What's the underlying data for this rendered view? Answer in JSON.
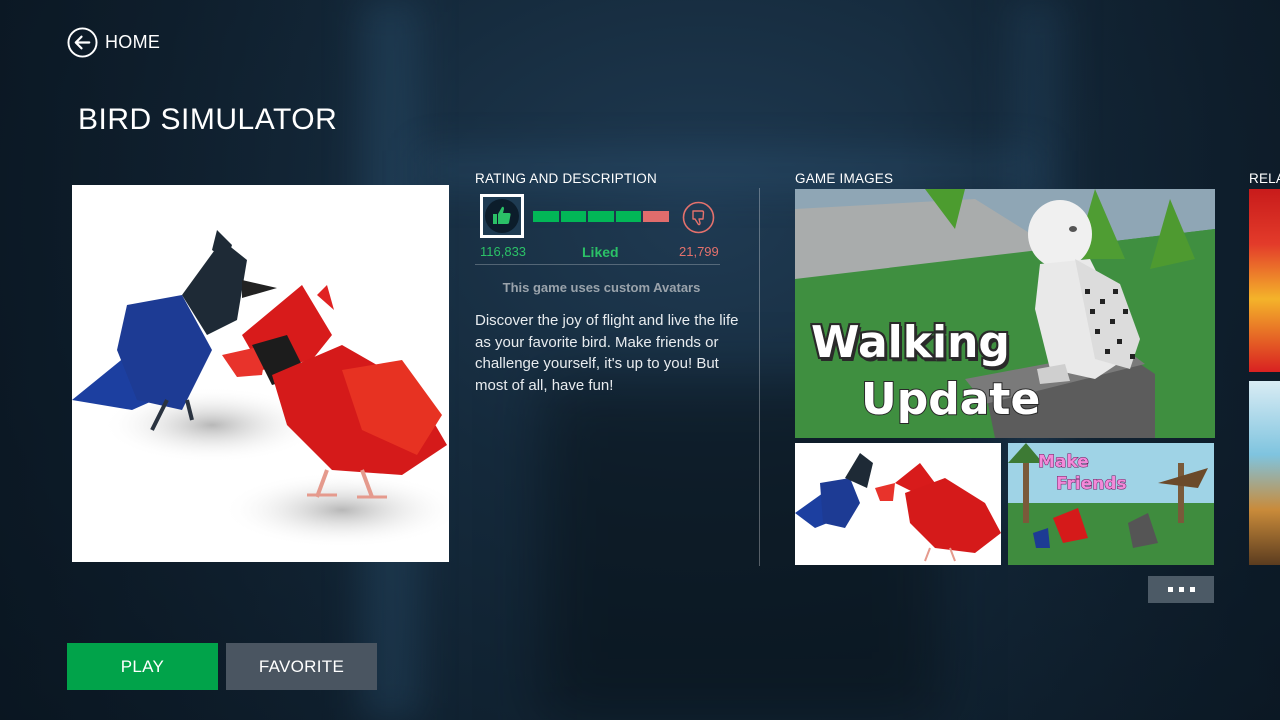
{
  "nav": {
    "home_label": "HOME"
  },
  "game": {
    "title": "BIRD SIMULATOR",
    "avatar_note": "This game uses custom Avatars",
    "description": "Discover the joy of flight and live the life as your favorite bird. Make friends or challenge yourself, it's up to you! But most of all, have fun!"
  },
  "rating": {
    "section_label": "RATING AND DESCRIPTION",
    "up_votes": "116,833",
    "down_votes": "21,799",
    "status": "Liked",
    "liked_fraction": 0.84,
    "colors": {
      "up": "#2bc167",
      "down": "#e4716c",
      "bar_up": "#02b757",
      "bar_down": "#e06c6c"
    }
  },
  "images": {
    "section_label": "GAME IMAGES",
    "main_overlay_line1": "Walking",
    "main_overlay_line2": "Update",
    "small2_overlay_line1": "Make",
    "small2_overlay_line2": "Friends"
  },
  "related": {
    "section_label": "RELA"
  },
  "actions": {
    "play_label": "PLAY",
    "favorite_label": "FAVORITE"
  },
  "colors": {
    "play": "#01a34a",
    "favorite": "#4a5561",
    "background": "#152a3c"
  }
}
